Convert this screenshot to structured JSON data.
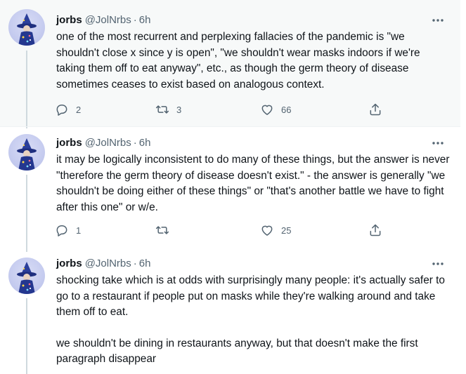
{
  "thread": {
    "tweets": [
      {
        "author_name": "jorbs",
        "author_handle": "@JolNrbs",
        "separator": "·",
        "time": "6h",
        "text": "one of the most recurrent and perplexing fallacies of the pandemic is \"we shouldn't close x since y is open\", \"we shouldn't wear masks indoors if we're taking them off to eat anyway\", etc., as though the germ theory of disease sometimes ceases to exist based on analogous context.",
        "replies": "2",
        "retweets": "3",
        "likes": "66"
      },
      {
        "author_name": "jorbs",
        "author_handle": "@JolNrbs",
        "separator": "·",
        "time": "6h",
        "text": "it may be logically inconsistent to do many of these things, but the answer is never \"therefore the germ theory of disease doesn't exist.\" - the answer is generally \"we shouldn't be doing either of these things\" or \"that's another battle we have to fight after this one\" or w/e.",
        "replies": "1",
        "retweets": "",
        "likes": "25"
      },
      {
        "author_name": "jorbs",
        "author_handle": "@JolNrbs",
        "separator": "·",
        "time": "6h",
        "text": "shocking take which is at odds with surprisingly many people: it's actually safer to go to a restaurant if people put on masks while they're walking around and take them off to eat.",
        "text2": "we shouldn't be dining in restaurants anyway, but that doesn't make the first paragraph disappear"
      }
    ]
  },
  "icons": {
    "more": "more-icon",
    "reply": "reply-icon",
    "retweet": "retweet-icon",
    "like": "like-icon",
    "share": "share-icon",
    "avatar": "avatar"
  },
  "colors": {
    "text": "#0f1419",
    "secondary": "#536471",
    "highlight_bg": "#f7f9f9",
    "thread_line": "#cfd9de"
  }
}
